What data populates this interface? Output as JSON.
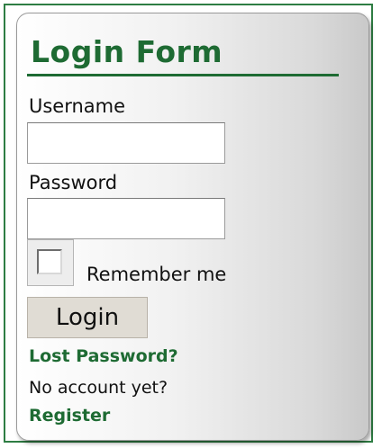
{
  "login_form": {
    "title": "Login Form",
    "username_label": "Username",
    "username_value": "",
    "password_label": "Password",
    "password_value": "",
    "remember_label": "Remember me",
    "remember_checked": false,
    "login_button_label": "Login",
    "lost_password_link": "Lost Password?",
    "no_account_text": "No account yet?",
    "register_link": "Register"
  },
  "colors": {
    "accent_green": "#1e6b33",
    "frame_green": "#2e7d43",
    "button_bg": "#e0dcd4"
  }
}
